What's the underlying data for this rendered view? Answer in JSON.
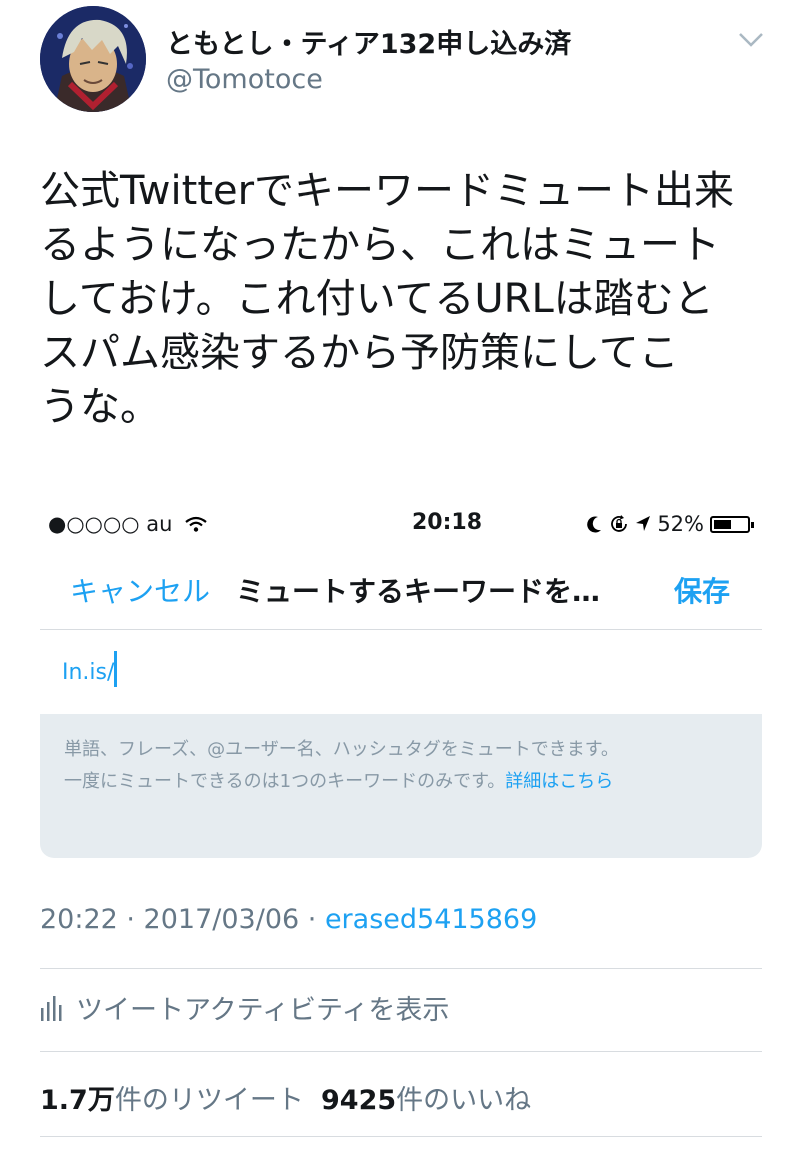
{
  "tweet": {
    "display_name": "ともとし・ティア132申し込み済",
    "handle": "@Tomotoce",
    "text_lines": [
      "公式Twitterでキーワードミュート出来",
      "るようになったから、これはミュート",
      "しておけ。これ付いてるURLは踏むと",
      "スパム感染するから予防策にしてこ",
      "うな。"
    ],
    "timestamp": "20:22 · 2017/03/06 · ",
    "via": "erased5415869",
    "activity_label": "ツイートアクティビティを表示",
    "retweet_count": "1.7万",
    "retweet_label": "件のリツイート",
    "like_count": "9425",
    "like_label": "件のいいね"
  },
  "embedded": {
    "status": {
      "carrier": "●○○○○ au",
      "time": "20:18",
      "battery": "52%",
      "battery_level": 0.52
    },
    "nav": {
      "cancel": "キャンセル",
      "title": "ミュートするキーワードを…",
      "save": "保存"
    },
    "input_value": "In.is/",
    "help_line1": "単語、フレーズ、@ユーザー名、ハッシュタグをミュートできます。",
    "help_line2": "一度にミュートできるのは1つのキーワードのみです。",
    "help_link": "詳細はこちら"
  },
  "colors": {
    "accent": "#1da1f2",
    "muted": "#657786",
    "help_bg": "#e6ecf0"
  },
  "icons": [
    "chevron-down-icon",
    "wifi-icon",
    "moon-icon",
    "rotation-lock-icon",
    "location-icon",
    "battery-icon",
    "bar-chart-icon"
  ]
}
